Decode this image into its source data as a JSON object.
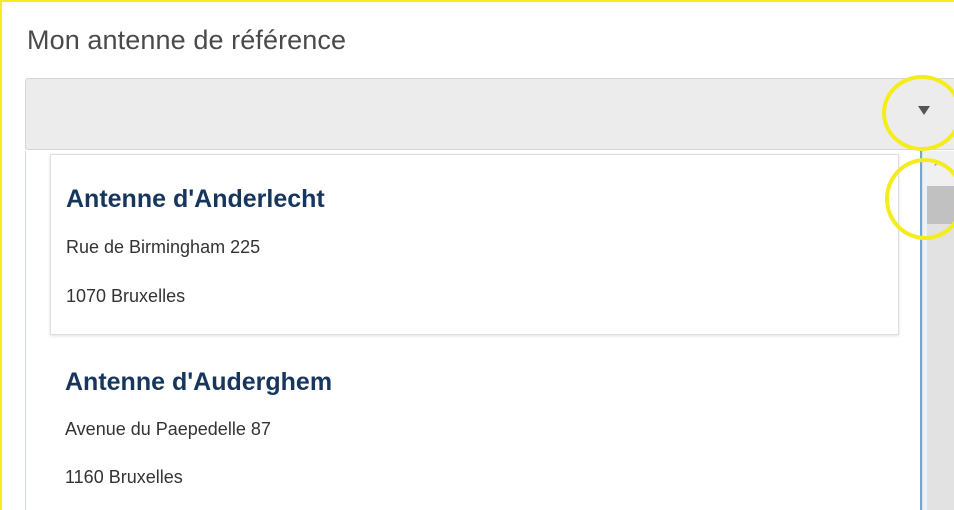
{
  "field": {
    "label": "Mon antenne de référence",
    "selected_value": "",
    "arrow_icon": "caret-down-icon"
  },
  "options": [
    {
      "title": "Antenne d'Anderlecht",
      "street": "Rue de Birmingham 225",
      "city": "1070 Bruxelles"
    },
    {
      "title": "Antenne d'Auderghem",
      "street": "Avenue du Paepedelle 87",
      "city": "1160 Bruxelles"
    }
  ],
  "scrollbar": {
    "up_glyph": "^"
  },
  "colors": {
    "highlight": "#f5ec1c",
    "option_title": "#17365d",
    "select_bg": "#ececec"
  }
}
